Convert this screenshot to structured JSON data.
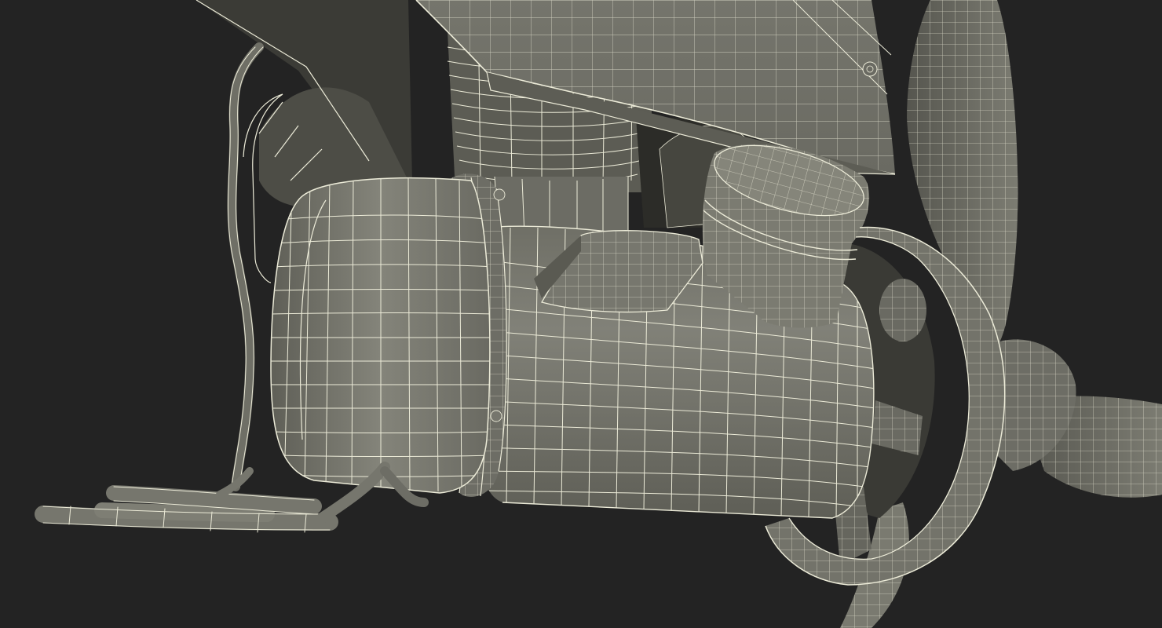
{
  "viewport": {
    "background_color": "#232323",
    "mesh_fill_color": "#7a7a70",
    "mesh_shadow_color": "#55554d",
    "wire_color": "#ecebd8"
  },
  "scene": {
    "subject": "wireframe-motor-assembly",
    "parts": [
      "mounting-bracket",
      "threaded-shaft",
      "motor-housing",
      "end-cap",
      "top-cylinder",
      "side-nub",
      "propeller-guard-ring",
      "propeller-blades",
      "cables"
    ]
  }
}
